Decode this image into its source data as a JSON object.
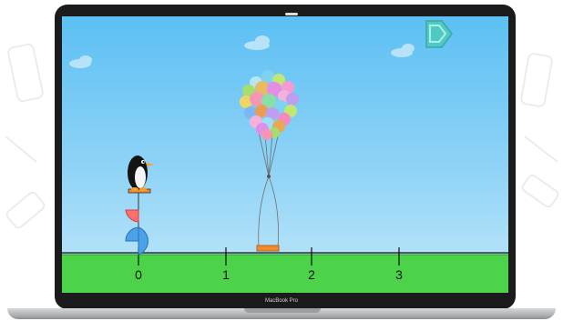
{
  "device": {
    "label": "MacBook Pro"
  },
  "game": {
    "number_line": {
      "tick_labels": [
        "0",
        "1",
        "2",
        "3"
      ]
    },
    "colors": {
      "sky_top": "#5cc0f3",
      "grass": "#4cd34a",
      "platform": "#f08a2e",
      "shape_red": "#ff6f6f",
      "shape_blue": "#4aa3e8",
      "next_button": "#4fc9c1"
    },
    "icons": [
      "next-arrow-icon",
      "penguin-icon",
      "balloon-bunch-icon"
    ]
  }
}
